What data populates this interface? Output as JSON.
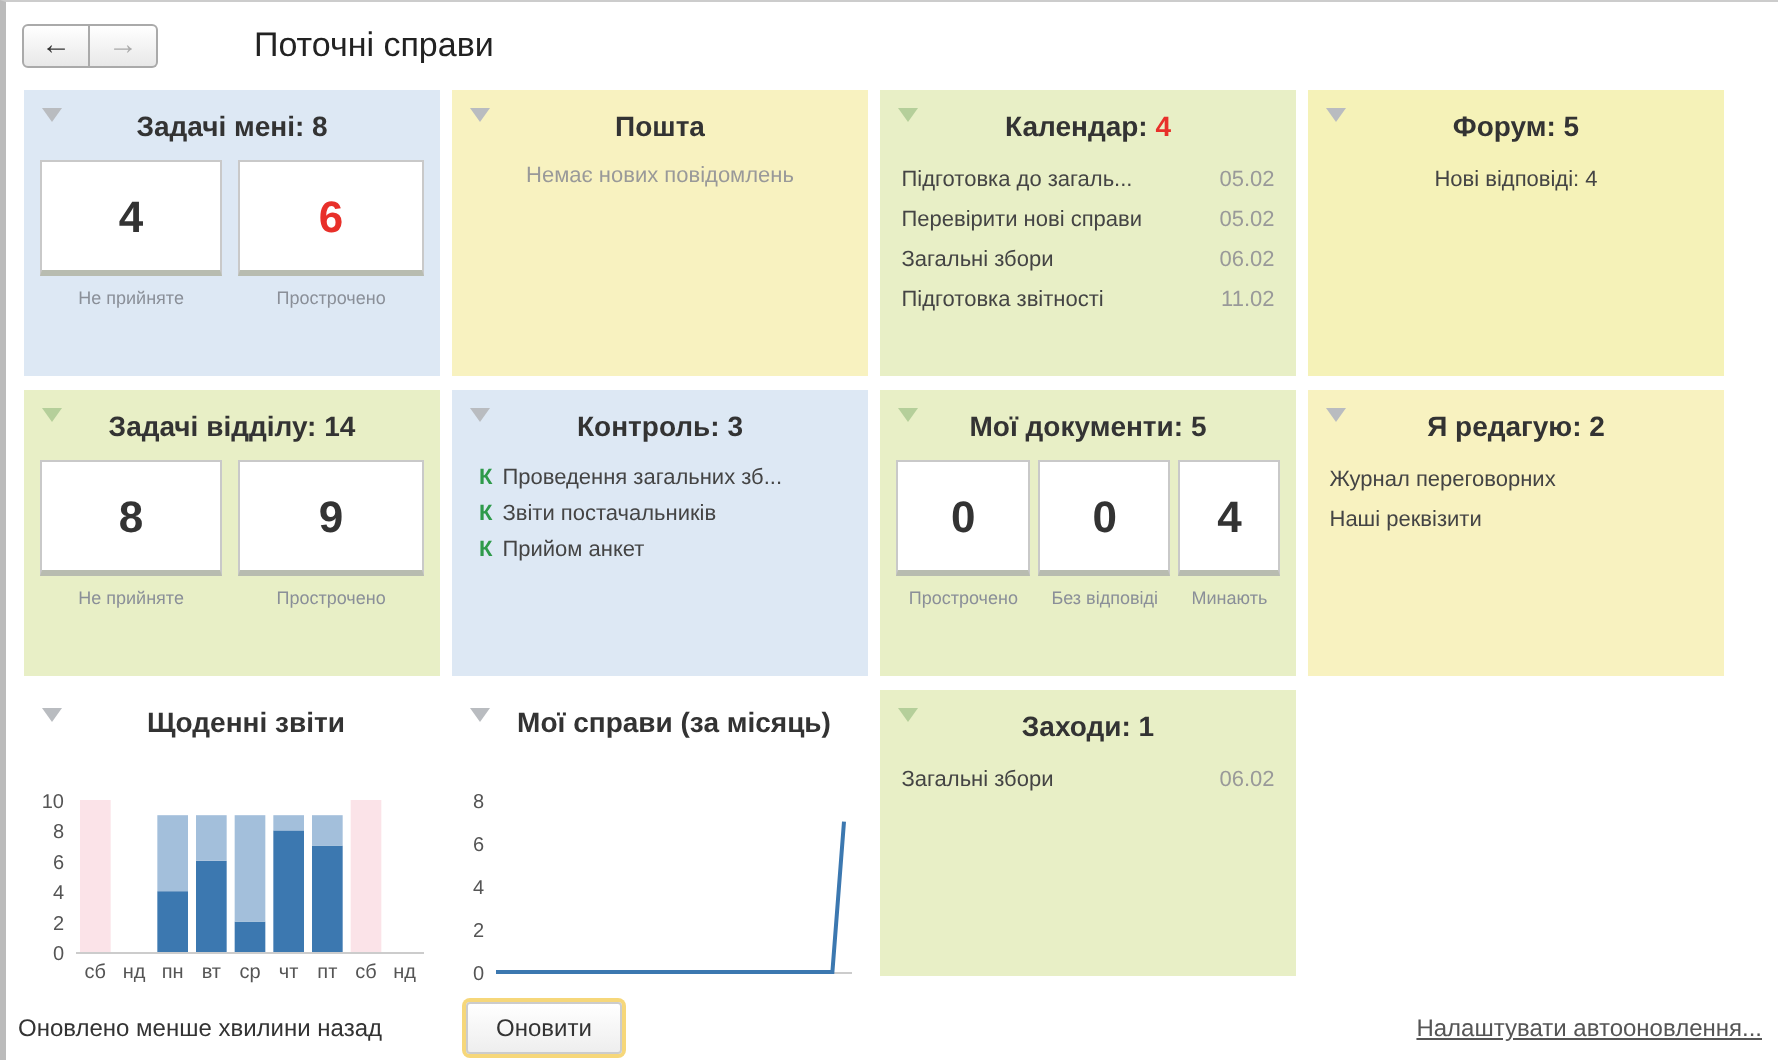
{
  "header": {
    "back": {
      "label": "←",
      "disabled": false
    },
    "forward": {
      "label": "→",
      "disabled": true
    },
    "title": "Поточні справи"
  },
  "panels": [
    {
      "kind": "counters",
      "color": "#dde8f4",
      "title": "Задачі мені: 8",
      "counters": [
        {
          "value": "4",
          "label": "Не прийняте",
          "alert": false
        },
        {
          "value": "6",
          "label": "Прострочено",
          "alert": true
        }
      ]
    },
    {
      "kind": "message",
      "color": "#f8f2c0",
      "title": "Пошта",
      "message": "Немає нових повідомлень"
    },
    {
      "kind": "dated_list",
      "color": "#e8efc6",
      "title": "Календар:",
      "count": {
        "text": "4",
        "alert": true
      },
      "items": [
        {
          "text": "Підготовка до загаль...",
          "date": "05.02"
        },
        {
          "text": "Перевірити нові справи",
          "date": "05.02"
        },
        {
          "text": "Загальні збори",
          "date": "06.02"
        },
        {
          "text": "Підготовка звітності",
          "date": "11.02"
        }
      ]
    },
    {
      "kind": "plain_list",
      "color": "#f5f2b8",
      "title": "Форум: 5",
      "centered": true,
      "items": [
        "Нові відповіді: 4"
      ]
    },
    {
      "kind": "counters",
      "color": "#e8efc6",
      "title": "Задачі відділу: 14",
      "counters": [
        {
          "value": "8",
          "label": "Не прийняте",
          "alert": false
        },
        {
          "value": "9",
          "label": "Прострочено",
          "alert": false
        }
      ]
    },
    {
      "kind": "control_list",
      "color": "#dde8f4",
      "title": "Контроль: 3",
      "items": [
        {
          "mark": "К",
          "text": "Проведення загальних зб..."
        },
        {
          "mark": "К",
          "text": "Звіти постачальників"
        },
        {
          "mark": "К",
          "text": "Прийом анкет"
        }
      ]
    },
    {
      "kind": "counters",
      "color": "#e8efc6",
      "title": "Мої документи: 5",
      "counters": [
        {
          "value": "0",
          "label": "Прострочено",
          "alert": false
        },
        {
          "value": "0",
          "label": "Без відповіді",
          "alert": false
        },
        {
          "value": "4",
          "label": "Минають",
          "alert": false
        }
      ]
    },
    {
      "kind": "plain_list",
      "color": "#f8f2c0",
      "title": "Я редагую: 2",
      "centered": false,
      "items": [
        "Журнал переговорних",
        "Наші реквізити"
      ]
    },
    {
      "kind": "chart",
      "title": "Щоденні звіти",
      "chart_data": {
        "type": "bar",
        "stacked": true,
        "categories": [
          "сб",
          "нд",
          "пн",
          "вт",
          "ср",
          "чт",
          "пт",
          "сб",
          "нд"
        ],
        "ylim": [
          0,
          10
        ],
        "yticks": [
          0,
          2,
          4,
          6,
          8,
          10
        ],
        "series": [
          {
            "color": "#3c78b0",
            "values": [
              0,
              0,
              4,
              6,
              2,
              8,
              7,
              0,
              0
            ]
          },
          {
            "color": "#a3bfdb",
            "values": [
              0,
              0,
              5,
              3,
              7,
              1,
              2,
              0,
              0
            ]
          },
          {
            "color": "#fbe3e8",
            "values": [
              10,
              0,
              0,
              0,
              0,
              0,
              0,
              10,
              0
            ]
          }
        ]
      }
    },
    {
      "kind": "chart",
      "title": "Мої справи (за місяць)",
      "chart_data": {
        "type": "line",
        "ylim": [
          0,
          8
        ],
        "yticks": [
          0,
          2,
          4,
          6,
          8
        ],
        "series": [
          {
            "color": "#3c78b0",
            "values": [
              0,
              0,
              0,
              0,
              0,
              0,
              0,
              0,
              0,
              0,
              0,
              0,
              0,
              0,
              0,
              0,
              0,
              0,
              0,
              0,
              0,
              0,
              0,
              0,
              0,
              0,
              0,
              0,
              0,
              0,
              7
            ]
          }
        ]
      }
    },
    {
      "kind": "dated_list",
      "color": "#e8efc6",
      "title": "Заходи: 1",
      "items": [
        {
          "text": "Загальні збори",
          "date": "06.02"
        }
      ]
    }
  ],
  "footer": {
    "status": "Оновлено менше хвилини назад",
    "refresh_button": "Оновити",
    "settings_link": "Налаштувати автооновлення..."
  }
}
